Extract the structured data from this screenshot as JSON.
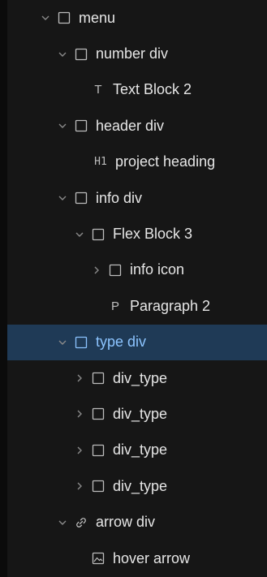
{
  "navigator": {
    "selected_color": "#8cc4ff",
    "selected_bg": "#1f3a56",
    "items": [
      {
        "label": "menu",
        "icon": "box-icon",
        "toggle": "expanded",
        "depth": 0
      },
      {
        "label": "number div",
        "icon": "box-icon",
        "toggle": "expanded",
        "depth": 1
      },
      {
        "label": "Text Block 2",
        "icon": "text-block-icon",
        "glyph": "T",
        "toggle": "none",
        "depth": 2
      },
      {
        "label": "header div",
        "icon": "box-icon",
        "toggle": "expanded",
        "depth": 1
      },
      {
        "label": "project heading",
        "icon": "heading-icon",
        "glyph": "H1",
        "toggle": "none",
        "depth": 2
      },
      {
        "label": "info div",
        "icon": "box-icon",
        "toggle": "expanded",
        "depth": 1
      },
      {
        "label": "Flex Block 3",
        "icon": "box-icon",
        "toggle": "expanded",
        "depth": 2
      },
      {
        "label": "info icon",
        "icon": "box-icon",
        "toggle": "collapsed",
        "depth": 3
      },
      {
        "label": "Paragraph 2",
        "icon": "paragraph-icon",
        "glyph": "P",
        "toggle": "none",
        "depth": 3
      },
      {
        "label": "type div",
        "icon": "box-icon",
        "toggle": "expanded",
        "depth": 1,
        "selected": true
      },
      {
        "label": "div_type",
        "icon": "box-icon",
        "toggle": "collapsed",
        "depth": 2
      },
      {
        "label": "div_type",
        "icon": "box-icon",
        "toggle": "collapsed",
        "depth": 2
      },
      {
        "label": "div_type",
        "icon": "box-icon",
        "toggle": "collapsed",
        "depth": 2
      },
      {
        "label": "div_type",
        "icon": "box-icon",
        "toggle": "collapsed",
        "depth": 2
      },
      {
        "label": "arrow div",
        "icon": "link-icon",
        "toggle": "expanded",
        "depth": 1
      },
      {
        "label": "hover arrow",
        "icon": "image-icon",
        "toggle": "none",
        "depth": 2
      }
    ]
  }
}
